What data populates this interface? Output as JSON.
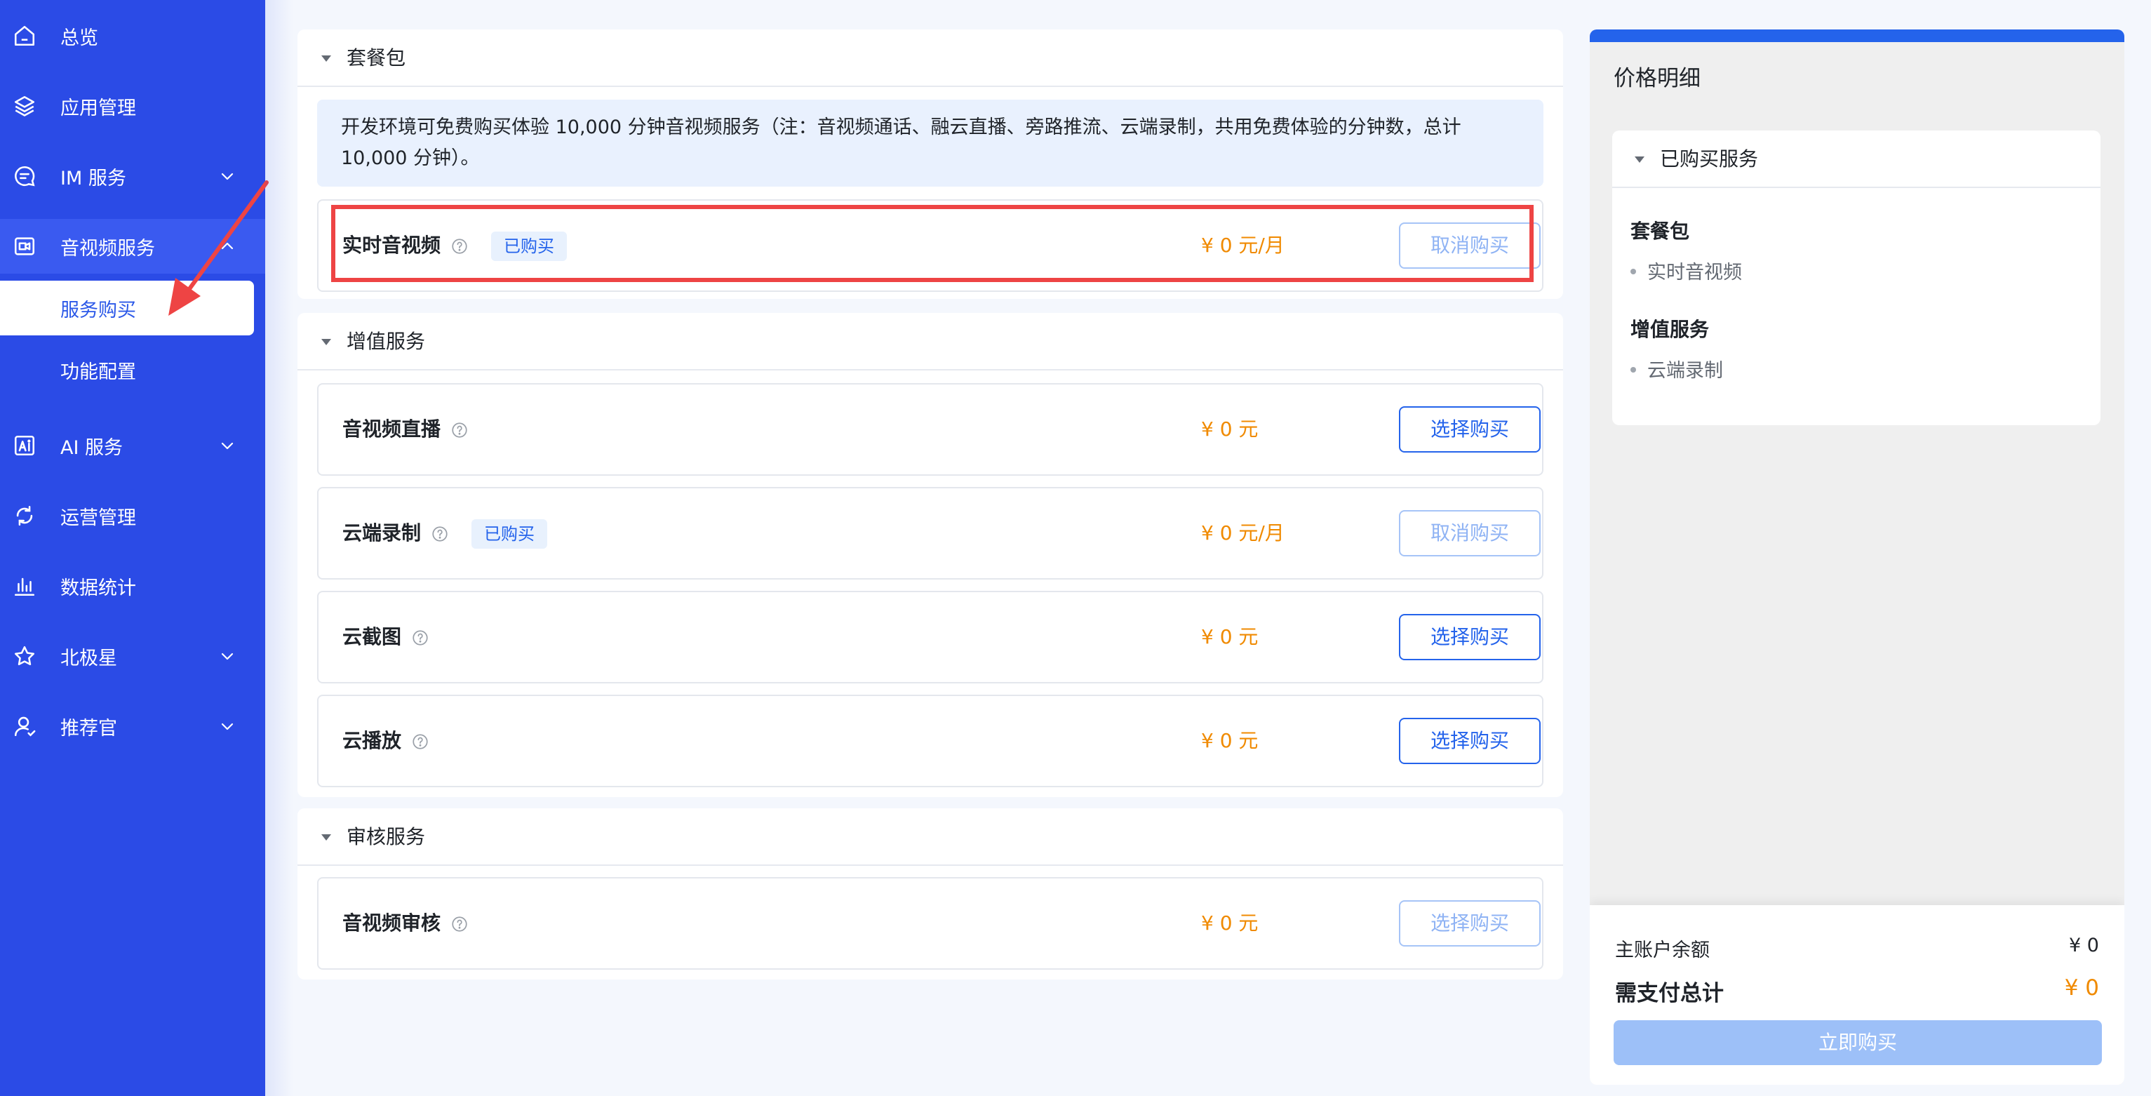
{
  "sidebar": {
    "items": [
      {
        "label": "总览",
        "icon": "home-icon"
      },
      {
        "label": "应用管理",
        "icon": "layers-icon"
      },
      {
        "label": "IM 服务",
        "icon": "chat-icon"
      },
      {
        "label": "音视频服务",
        "icon": "video-icon"
      },
      {
        "label": "AI 服务",
        "icon": "ai-icon"
      },
      {
        "label": "运营管理",
        "icon": "refresh-icon"
      },
      {
        "label": "数据统计",
        "icon": "bar-chart-icon"
      },
      {
        "label": "北极星",
        "icon": "star-icon"
      },
      {
        "label": "推荐官",
        "icon": "user-icon"
      }
    ],
    "sub_items": [
      {
        "label": "服务购买",
        "active": true
      },
      {
        "label": "功能配置",
        "active": false
      }
    ]
  },
  "sections": {
    "package": {
      "title": "套餐包",
      "notice": "开发环境可免费购买体验 10,000 分钟音视频服务（注：音视频通话、融云直播、旁路推流、云端录制，共用免费体验的分钟数，总计 10,000 分钟）。",
      "rows": [
        {
          "name": "实时音视频",
          "tag": "已购买",
          "price": "¥ 0 元/月",
          "button": "取消购买",
          "button_state": "disabled"
        }
      ]
    },
    "value_added": {
      "title": "增值服务",
      "rows": [
        {
          "name": "音视频直播",
          "tag": "",
          "price": "¥ 0 元",
          "button": "选择购买",
          "button_state": "enabled"
        },
        {
          "name": "云端录制",
          "tag": "已购买",
          "price": "¥ 0 元/月",
          "button": "取消购买",
          "button_state": "disabled"
        },
        {
          "name": "云截图",
          "tag": "",
          "price": "¥ 0 元",
          "button": "选择购买",
          "button_state": "enabled"
        },
        {
          "name": "云播放",
          "tag": "",
          "price": "¥ 0 元",
          "button": "选择购买",
          "button_state": "enabled"
        }
      ]
    },
    "review": {
      "title": "审核服务",
      "rows": [
        {
          "name": "音视频审核",
          "tag": "",
          "price": "¥ 0 元",
          "button": "选择购买",
          "button_state": "disabled"
        }
      ]
    }
  },
  "price_panel": {
    "title": "价格明细",
    "purchased_title": "已购买服务",
    "groups": [
      {
        "name": "套餐包",
        "items": [
          "实时音视频"
        ]
      },
      {
        "name": "增值服务",
        "items": [
          "云端录制"
        ]
      }
    ],
    "balance_label": "主账户余额",
    "balance_value": "¥ 0",
    "total_label": "需支付总计",
    "total_value": "¥ 0",
    "buy_button": "立即购买"
  },
  "colors": {
    "sidebar_bg": "#2b4be6",
    "primary": "#2463eb",
    "price": "#f08a00",
    "highlight": "#ee4444"
  }
}
